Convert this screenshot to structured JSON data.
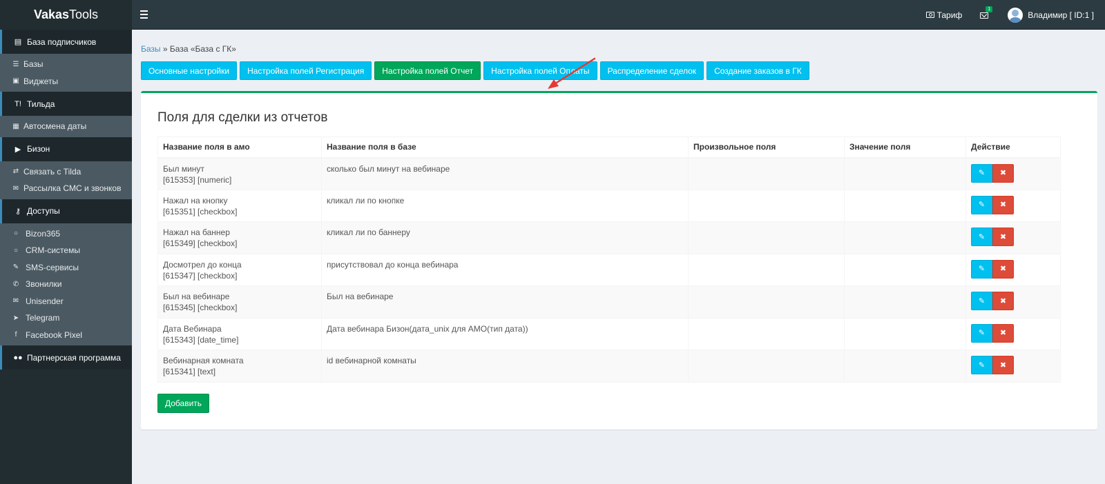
{
  "app": {
    "logo_bold": "Vakas",
    "logo_rest": "Tools"
  },
  "header": {
    "tarif_label": "Тариф",
    "mail_badge": "1",
    "user_label": "Владимир [ ID:1 ]"
  },
  "sidebar": {
    "sections": [
      {
        "label": "База подписчиков",
        "icon": "database-icon",
        "items": [
          {
            "label": "Базы",
            "icon": "db-icon"
          },
          {
            "label": "Виджеты",
            "icon": "widget-icon"
          }
        ]
      },
      {
        "label": "Тильда",
        "icon": "tilda-icon",
        "items": [
          {
            "label": "Автосмена даты",
            "icon": "calendar-icon"
          }
        ]
      },
      {
        "label": "Бизон",
        "icon": "youtube-icon",
        "items": [
          {
            "label": "Связать с Tilda",
            "icon": "exchange-icon"
          },
          {
            "label": "Рассылка СМС и звонков",
            "icon": "envelope-icon"
          }
        ]
      },
      {
        "label": "Доступы",
        "icon": "key-icon",
        "items": [
          {
            "label": "Bizon365",
            "icon": "circle-icon"
          },
          {
            "label": "CRM-системы",
            "icon": "circle-icon"
          },
          {
            "label": "SMS-сервисы",
            "icon": "comment-icon"
          },
          {
            "label": "Звонилки",
            "icon": "phone-icon"
          },
          {
            "label": "Unisender",
            "icon": "envelope-icon"
          },
          {
            "label": "Telegram",
            "icon": "telegram-icon"
          },
          {
            "label": "Facebook Pixel",
            "icon": "facebook-icon"
          }
        ]
      },
      {
        "label": "Партнерская программа",
        "icon": "users-icon",
        "items": []
      }
    ]
  },
  "breadcrumb": {
    "link": "Базы",
    "separator": "»",
    "current": "База «База с ГК»"
  },
  "tabs": [
    {
      "label": "Основные настройки",
      "active": false
    },
    {
      "label": "Настройка полей Регистрация",
      "active": false
    },
    {
      "label": "Настройка полей Отчет",
      "active": true
    },
    {
      "label": "Настройка полей Оплаты",
      "active": false
    },
    {
      "label": "Распределение сделок",
      "active": false
    },
    {
      "label": "Создание заказов в ГК",
      "active": false
    }
  ],
  "main": {
    "title": "Поля для сделки из отчетов",
    "columns": [
      "Название поля в амо",
      "Название поля в базе",
      "Произвольное поля",
      "Значение поля",
      "Действие"
    ],
    "rows": [
      {
        "amo_name": "Был минут",
        "amo_meta": "[615353] [numeric]",
        "base_name": "сколько был минут на вебинаре",
        "custom": "",
        "value": ""
      },
      {
        "amo_name": "Нажал на кнопку",
        "amo_meta": "[615351] [checkbox]",
        "base_name": "кликал ли по кнопке",
        "custom": "",
        "value": ""
      },
      {
        "amo_name": "Нажал на баннер",
        "amo_meta": "[615349] [checkbox]",
        "base_name": "кликал ли по баннеру",
        "custom": "",
        "value": ""
      },
      {
        "amo_name": "Досмотрел до конца",
        "amo_meta": "[615347] [checkbox]",
        "base_name": "присутствовал до конца вебинара",
        "custom": "",
        "value": ""
      },
      {
        "amo_name": "Был на вебинаре",
        "amo_meta": "[615345] [checkbox]",
        "base_name": "Был на вебинаре",
        "custom": "",
        "value": ""
      },
      {
        "amo_name": "Дата Вебинара",
        "amo_meta": "[615343] [date_time]",
        "base_name": "Дата вебинара Бизон(дата_unix для АМО(тип дата))",
        "custom": "",
        "value": ""
      },
      {
        "amo_name": "Вебинарная комната",
        "amo_meta": "[615341] [text]",
        "base_name": "id вебинарной комнаты",
        "custom": "",
        "value": ""
      }
    ],
    "add_button": "Добавить"
  },
  "colors": {
    "sidebar_bg": "#222d32",
    "header_bg": "#2c3b41",
    "tab_blue": "#00c0ef",
    "tab_green": "#00a65a",
    "delete_red": "#dd4b39",
    "arrow_red": "#e53935"
  }
}
